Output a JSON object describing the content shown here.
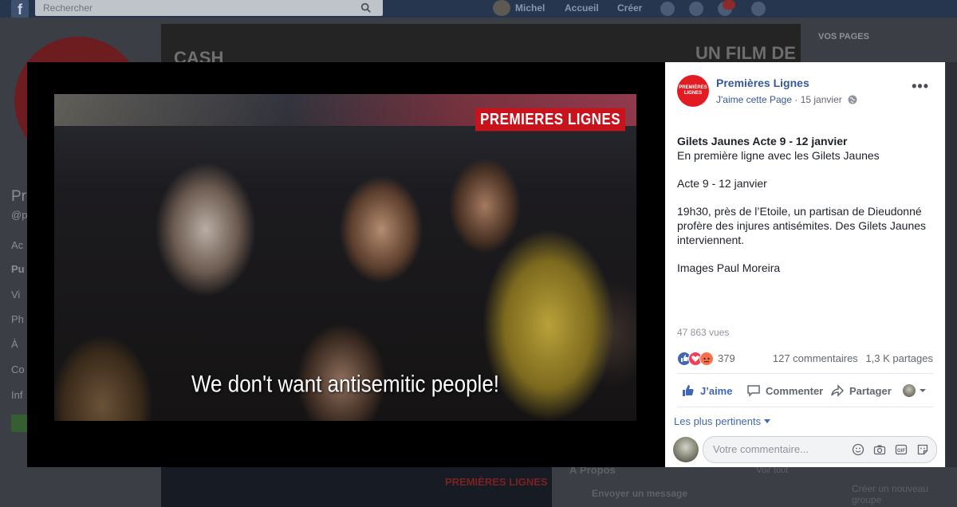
{
  "topbar": {
    "search_placeholder": "Rechercher",
    "user_name": "Michel",
    "nav_home": "Accueil",
    "nav_create": "Créer"
  },
  "background": {
    "right_title": "VOS PAGES",
    "cover_text": "UN FILM DE",
    "cover_text_left": "CASH",
    "bottom_brand": "PREMIÈRES LIGNES",
    "about_title": "À Propos",
    "see_all": "Voir tout",
    "send_message": "Envoyer un message",
    "create_group": "Créer un nouveau groupe"
  },
  "video": {
    "brand_overlay": "PREMIERES LIGNES",
    "subtitle": "We don't want antisemitic people!"
  },
  "post": {
    "page_logo_text": "PREMIÈRES LIGNES",
    "page_name": "Premières Lignes",
    "like_page": "J'aime cette Page",
    "separator": "·",
    "date": "15 janvier",
    "title": "Gilets Jaunes Acte 9 - 12 janvier",
    "line1": "En première ligne avec les Gilets Jaunes",
    "line2": "Acte 9 - 12 janvier",
    "line3": "19h30, près de l’Etoile, un partisan de Dieudonné profère des injures antisémites. Des Gilets Jaunes interviennent.",
    "line4": "Images Paul Moreira",
    "views": "47 863 vues",
    "reaction_count": "379",
    "comments": "127 commentaires",
    "shares": "1,3 K partages"
  },
  "actions": {
    "like": "J’aime",
    "comment": "Commenter",
    "share": "Partager"
  },
  "comments": {
    "sort": "Les plus pertinents",
    "placeholder": "Votre commentaire..."
  },
  "colors": {
    "facebook_blue": "#4267b2",
    "link_blue": "#365899",
    "brand_red": "#e31b23"
  }
}
